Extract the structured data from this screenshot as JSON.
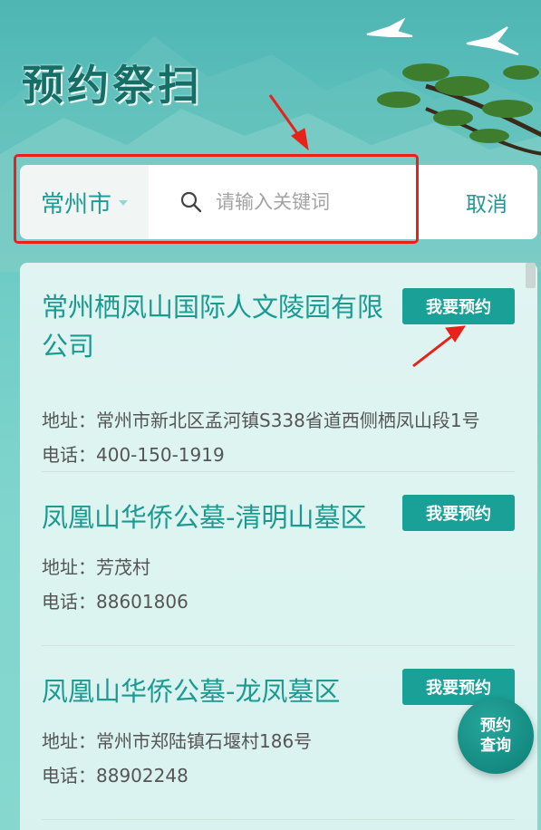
{
  "header": {
    "title": "预约祭扫"
  },
  "search": {
    "city": "常州市",
    "placeholder": "请输入关键词",
    "value": "",
    "cancel_label": "取消"
  },
  "reserve_label": "我要预约",
  "cemeteries": [
    {
      "name": "常州栖凤山国际人文陵园有限公司",
      "address_label": "地址：",
      "address": "常州市新北区孟河镇S338省道西侧栖凤山段1号",
      "phone_label": "电话：",
      "phone": "400-150-1919"
    },
    {
      "name": "凤凰山华侨公墓-清明山墓区",
      "address_label": "地址：",
      "address": "芳茂村",
      "phone_label": "电话：",
      "phone": "88601806"
    },
    {
      "name": "凤凰山华侨公墓-龙凤墓区",
      "address_label": "地址：",
      "address": "常州市郑陆镇石堰村186号",
      "phone_label": "电话：",
      "phone": "88902248"
    }
  ],
  "float_button": {
    "line1": "预约",
    "line2": "查询"
  },
  "colors": {
    "accent": "#1aa197",
    "highlight": "#e8221a",
    "title": "#166e66"
  }
}
